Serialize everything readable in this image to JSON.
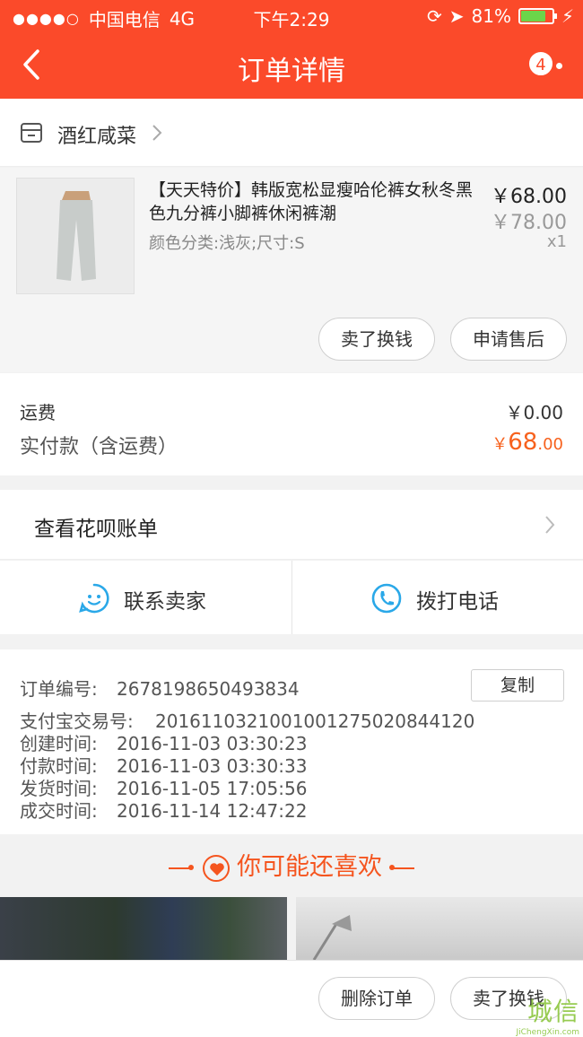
{
  "status_bar": {
    "carrier": "中国电信",
    "network": "4G",
    "time": "下午2:29",
    "battery": "81%"
  },
  "header": {
    "title": "订单详情",
    "badge_count": "4"
  },
  "store": {
    "name": "酒红咸菜"
  },
  "product": {
    "title": "【天天特价】韩版宽松显瘦哈伦裤女秋冬黑色九分裤小脚裤休闲裤潮",
    "spec": "颜色分类:浅灰;尺寸:S",
    "price": "￥68.00",
    "original_price": "￥78.00",
    "quantity": "x1",
    "btn_sell": "卖了换钱",
    "btn_after_sale": "申请售后"
  },
  "fees": {
    "shipping_label": "运费",
    "shipping_value": "￥0.00",
    "paid_label": "实付款（含运费）",
    "paid_currency": "￥",
    "paid_int": "68",
    "paid_dec": ".00"
  },
  "huabei": {
    "label": "查看花呗账单"
  },
  "contact": {
    "seller": "联系卖家",
    "phone": "拨打电话"
  },
  "order_info": {
    "copy_label": "复制",
    "lines": [
      {
        "k": "订单编号:",
        "v": "2678198650493834"
      },
      {
        "k": "支付宝交易号:",
        "v": "2016110321001001275020844120"
      },
      {
        "k": "创建时间:",
        "v": "2016-11-03 03:30:23"
      },
      {
        "k": "付款时间:",
        "v": "2016-11-03 03:30:33"
      },
      {
        "k": "发货时间:",
        "v": "2016-11-05 17:05:56"
      },
      {
        "k": "成交时间:",
        "v": "2016-11-14 12:47:22"
      }
    ]
  },
  "recommend": {
    "title": "你可能还喜欢"
  },
  "bottom": {
    "delete_order": "删除订单",
    "sell": "卖了换钱"
  },
  "watermark": {
    "text": "城信",
    "url": "JiChengXin.com"
  },
  "colors": {
    "brand": "#fb4a2a",
    "accent": "#f7611d",
    "icon_blue": "#2aa8e8"
  }
}
